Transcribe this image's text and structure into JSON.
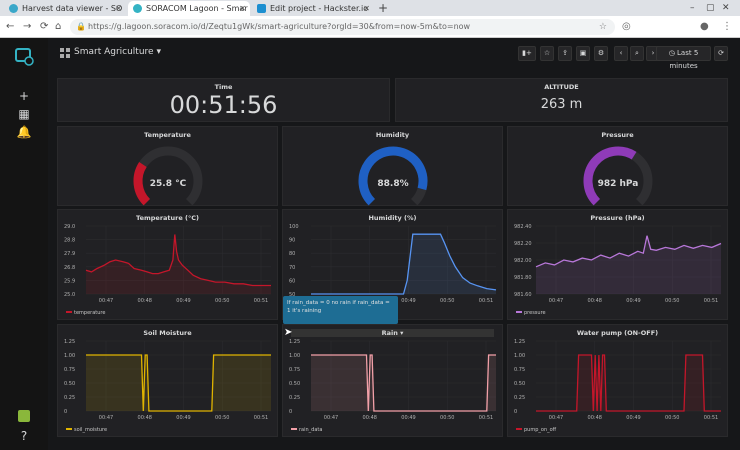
{
  "browser": {
    "tabs": [
      {
        "label": "Harvest data viewer - SO",
        "color": "#3aa7c9"
      },
      {
        "label": "SORACOM Lagoon - Smar",
        "color": "#34b3c4"
      },
      {
        "label": "Edit project - Hackster.io",
        "color": "#1d8fd0"
      }
    ],
    "url": "https://g.lagoon.soracom.io/d/Zeqtu1gWk/smart-agriculture?orgId=30&from=now-5m&to=now"
  },
  "dashboard": {
    "title": "Smart Agriculture",
    "time_range": "Last 5 minutes"
  },
  "panels": {
    "time": {
      "title": "Time",
      "value": "00:51:56"
    },
    "altitude": {
      "title": "ALTITUDE",
      "value": "263 m"
    },
    "temperature_gauge": {
      "title": "Temperature",
      "value": "25.8 °C",
      "fraction": 0.29,
      "color": "#c4162a"
    },
    "humidity_gauge": {
      "title": "Humidity",
      "value": "88.8%",
      "fraction": 0.89,
      "color": "#1f60c4"
    },
    "pressure_gauge": {
      "title": "Pressure",
      "value": "982 hPa",
      "fraction": 0.62,
      "color": "#8f3bb8"
    }
  },
  "tooltip": "If rain_data = 0 no rain if rain_data = 1 it's raining",
  "charts": {
    "x_ticks": [
      "00:47",
      "00:48",
      "00:49",
      "00:50",
      "00:51"
    ],
    "temperature": {
      "title": "Temperature (°C)",
      "legend": "temperature"
    },
    "humidity": {
      "title": "Humidity (%)",
      "legend": "humidity"
    },
    "pressure": {
      "title": "Pressure (hPa)",
      "legend": "pressure"
    },
    "soil": {
      "title": "Soil Moisture",
      "legend": "soil_moisture"
    },
    "rain": {
      "title": "Rain",
      "legend": "rain_data"
    },
    "pump": {
      "title": "Water pump (ON-OFF)",
      "legend": "pump_on_off"
    }
  },
  "chart_data": [
    {
      "type": "line",
      "title": "Temperature (°C)",
      "color": "#c4162a",
      "yticks": [
        "25.0",
        "25.9",
        "26.8",
        "27.9",
        "28.8",
        "29.0"
      ],
      "ylim": [
        25.0,
        29.0
      ],
      "x": [
        0,
        0.03,
        0.06,
        0.1,
        0.13,
        0.16,
        0.2,
        0.23,
        0.26,
        0.3,
        0.33,
        0.36,
        0.39,
        0.42,
        0.45,
        0.47,
        0.48,
        0.49,
        0.5,
        0.52,
        0.55,
        0.58,
        0.62,
        0.66,
        0.7,
        0.75,
        0.8,
        0.85,
        0.9,
        0.95,
        1.0
      ],
      "values": [
        26.4,
        26.3,
        26.5,
        26.7,
        26.9,
        27.0,
        26.9,
        26.8,
        26.5,
        26.4,
        26.3,
        26.2,
        26.2,
        26.3,
        26.4,
        27.0,
        28.5,
        27.5,
        27.0,
        26.7,
        26.4,
        26.1,
        25.9,
        25.8,
        25.7,
        25.7,
        25.6,
        25.6,
        25.5,
        25.5,
        25.5
      ]
    },
    {
      "type": "line",
      "title": "Humidity (%)",
      "color": "#5794f2",
      "yticks": [
        "50",
        "60",
        "70",
        "80",
        "90",
        "100"
      ],
      "ylim": [
        50,
        100
      ],
      "x": [
        0,
        0.1,
        0.2,
        0.3,
        0.4,
        0.5,
        0.52,
        0.55,
        0.6,
        0.65,
        0.7,
        0.72,
        0.75,
        0.78,
        0.82,
        0.86,
        0.9,
        0.95,
        1.0
      ],
      "values": [
        50,
        50,
        50,
        50,
        50,
        50,
        60,
        94,
        94,
        94,
        94,
        88,
        78,
        70,
        62,
        58,
        56,
        54,
        53
      ]
    },
    {
      "type": "line",
      "title": "Pressure (hPa)",
      "color": "#b877d9",
      "yticks": [
        "981.60",
        "981.80",
        "982.00",
        "982.20",
        "982.40"
      ],
      "ylim": [
        981.6,
        982.3
      ],
      "x": [
        0,
        0.05,
        0.1,
        0.15,
        0.2,
        0.25,
        0.3,
        0.35,
        0.4,
        0.45,
        0.5,
        0.55,
        0.58,
        0.6,
        0.62,
        0.65,
        0.7,
        0.75,
        0.8,
        0.85,
        0.9,
        0.95,
        1.0
      ],
      "values": [
        981.88,
        981.92,
        981.9,
        981.95,
        981.93,
        981.97,
        981.95,
        982.0,
        981.97,
        982.02,
        981.99,
        982.04,
        982.02,
        982.2,
        982.06,
        982.05,
        982.08,
        982.06,
        982.1,
        982.07,
        982.1,
        982.08,
        982.12
      ]
    },
    {
      "type": "line",
      "title": "Soil Moisture",
      "color": "#e0b400",
      "yticks": [
        "0",
        "0.25",
        "0.50",
        "0.75",
        "1.00",
        "1.25"
      ],
      "ylim": [
        0,
        1.25
      ],
      "x": [
        0,
        0.3,
        0.31,
        0.32,
        0.33,
        0.34,
        0.35,
        0.36,
        0.37,
        0.68,
        0.69,
        1.0
      ],
      "values": [
        1,
        1,
        0,
        1,
        1,
        0,
        0,
        0,
        0,
        0,
        1,
        1
      ]
    },
    {
      "type": "line",
      "title": "Rain",
      "color": "#f2a0a8",
      "yticks": [
        "0",
        "0.25",
        "0.50",
        "0.75",
        "1.00",
        "1.25"
      ],
      "ylim": [
        0,
        1.25
      ],
      "x": [
        0,
        0.3,
        0.31,
        0.32,
        0.33,
        0.34,
        0.35,
        0.95,
        0.96,
        1.0
      ],
      "values": [
        1,
        1,
        0,
        1,
        1,
        0,
        0,
        0,
        1,
        1
      ]
    },
    {
      "type": "line",
      "title": "Water pump (ON-OFF)",
      "color": "#c4162a",
      "yticks": [
        "0",
        "0.25",
        "0.50",
        "0.75",
        "1.00",
        "1.25"
      ],
      "ylim": [
        0,
        1.25
      ],
      "x": [
        0,
        0.22,
        0.23,
        0.3,
        0.31,
        0.32,
        0.33,
        0.34,
        0.35,
        0.36,
        0.37,
        0.38,
        0.39,
        0.8,
        0.81,
        0.9,
        0.91,
        1.0
      ],
      "values": [
        0,
        0,
        1,
        1,
        0,
        1,
        0,
        1,
        0,
        1,
        1,
        0,
        0,
        0,
        1,
        1,
        0,
        0
      ]
    }
  ]
}
